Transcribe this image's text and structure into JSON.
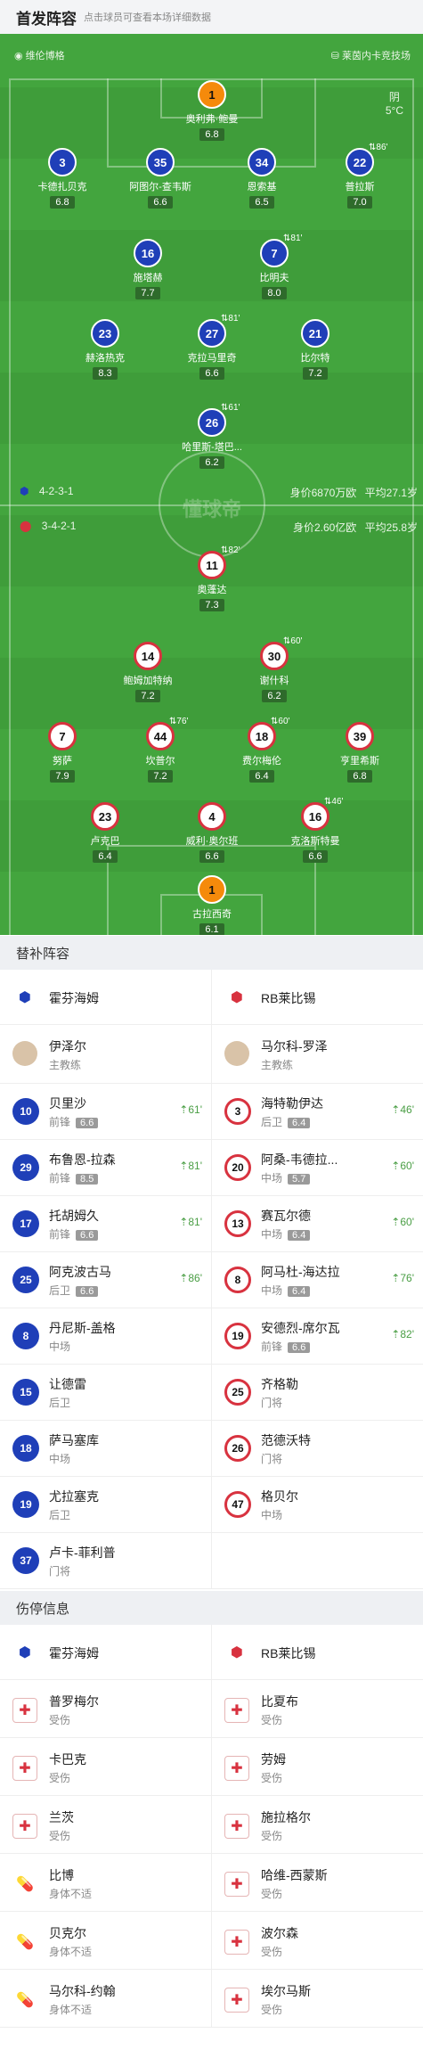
{
  "header": {
    "title": "首发阵容",
    "subtitle": "点击球员可查看本场详细数据"
  },
  "pitch": {
    "stadium": "维伦博格",
    "referee": "莱茵内卡竞技场",
    "weather": "阴",
    "temperature": "5°C",
    "watermark": "懂球帝",
    "home": {
      "formation": "4-2-3-1",
      "value": "身价6870万欧",
      "age": "平均27.1岁"
    },
    "away": {
      "formation": "3-4-2-1",
      "value": "身价2.60亿欧",
      "age": "平均25.8岁"
    }
  },
  "home_players": [
    {
      "num": "1",
      "name": "奥利弗·鲍曼",
      "rating": "6.8",
      "ev": ""
    },
    {
      "num": "3",
      "name": "卡德扎贝克",
      "rating": "6.8",
      "ev": ""
    },
    {
      "num": "35",
      "name": "阿图尔-查韦斯",
      "rating": "6.6",
      "ev": ""
    },
    {
      "num": "34",
      "name": "恩索基",
      "rating": "6.5",
      "ev": ""
    },
    {
      "num": "22",
      "name": "普拉斯",
      "rating": "7.0",
      "ev": "86'"
    },
    {
      "num": "16",
      "name": "施塔赫",
      "rating": "7.7",
      "ev": ""
    },
    {
      "num": "7",
      "name": "比明夫",
      "rating": "8.0",
      "ev": "81'"
    },
    {
      "num": "23",
      "name": "赫洛热克",
      "rating": "8.3",
      "ev": ""
    },
    {
      "num": "27",
      "name": "克拉马里奇",
      "rating": "6.6",
      "ev": "81'"
    },
    {
      "num": "21",
      "name": "比尔特",
      "rating": "7.2",
      "ev": ""
    },
    {
      "num": "26",
      "name": "哈里斯-塔巴...",
      "rating": "6.2",
      "ev": "61'"
    }
  ],
  "away_players": [
    {
      "num": "11",
      "name": "奥蓬达",
      "rating": "7.3",
      "ev": "82'"
    },
    {
      "num": "14",
      "name": "鲍姆加特纳",
      "rating": "7.2",
      "ev": ""
    },
    {
      "num": "30",
      "name": "谢什科",
      "rating": "6.2",
      "ev": "60'"
    },
    {
      "num": "7",
      "name": "努萨",
      "rating": "7.9",
      "ev": ""
    },
    {
      "num": "44",
      "name": "坎普尔",
      "rating": "7.2",
      "ev": "76'"
    },
    {
      "num": "18",
      "name": "费尔梅伦",
      "rating": "6.4",
      "ev": "60'"
    },
    {
      "num": "39",
      "name": "亨里希斯",
      "rating": "6.8",
      "ev": ""
    },
    {
      "num": "23",
      "name": "卢克巴",
      "rating": "6.4",
      "ev": ""
    },
    {
      "num": "4",
      "name": "威利·奥尔班",
      "rating": "6.6",
      "ev": ""
    },
    {
      "num": "16",
      "name": "克洛斯特曼",
      "rating": "6.6",
      "ev": "46'"
    },
    {
      "num": "1",
      "name": "古拉西奇",
      "rating": "6.1",
      "ev": ""
    }
  ],
  "subs": {
    "title": "替补阵容",
    "home_team": "霍芬海姆",
    "away_team": "RB莱比锡",
    "home_coach": {
      "name": "伊泽尔",
      "role": "主教练"
    },
    "away_coach": {
      "name": "马尔科-罗泽",
      "role": "主教练"
    },
    "home": [
      {
        "num": "10",
        "name": "贝里沙",
        "pos": "前锋",
        "rating": "6.6",
        "time": "61'"
      },
      {
        "num": "29",
        "name": "布鲁恩-拉森",
        "pos": "前锋",
        "rating": "8.5",
        "time": "81'"
      },
      {
        "num": "17",
        "name": "托胡姆久",
        "pos": "前锋",
        "rating": "6.6",
        "time": "81'"
      },
      {
        "num": "25",
        "name": "阿克波古马",
        "pos": "后卫",
        "rating": "6.6",
        "time": "86'"
      },
      {
        "num": "8",
        "name": "丹尼斯-盖格",
        "pos": "中场",
        "rating": "",
        "time": ""
      },
      {
        "num": "15",
        "name": "让德雷",
        "pos": "后卫",
        "rating": "",
        "time": ""
      },
      {
        "num": "18",
        "name": "萨马塞库",
        "pos": "中场",
        "rating": "",
        "time": ""
      },
      {
        "num": "19",
        "name": "尤拉塞克",
        "pos": "后卫",
        "rating": "",
        "time": ""
      },
      {
        "num": "37",
        "name": "卢卡-菲利普",
        "pos": "门将",
        "rating": "",
        "time": ""
      }
    ],
    "away": [
      {
        "num": "3",
        "name": "海特勒伊达",
        "pos": "后卫",
        "rating": "6.4",
        "time": "46'"
      },
      {
        "num": "20",
        "name": "阿桑-韦德拉...",
        "pos": "中场",
        "rating": "5.7",
        "time": "60'"
      },
      {
        "num": "13",
        "name": "赛瓦尔德",
        "pos": "中场",
        "rating": "6.4",
        "time": "60'"
      },
      {
        "num": "8",
        "name": "阿马杜-海达拉",
        "pos": "中场",
        "rating": "6.4",
        "time": "76'"
      },
      {
        "num": "19",
        "name": "安德烈-席尔瓦",
        "pos": "前锋",
        "rating": "6.6",
        "time": "82'"
      },
      {
        "num": "25",
        "name": "齐格勒",
        "pos": "门将",
        "rating": "",
        "time": ""
      },
      {
        "num": "26",
        "name": "范德沃特",
        "pos": "门将",
        "rating": "",
        "time": ""
      },
      {
        "num": "47",
        "name": "格贝尔",
        "pos": "中场",
        "rating": "",
        "time": ""
      }
    ]
  },
  "injuries": {
    "title": "伤停信息",
    "home_team": "霍芬海姆",
    "away_team": "RB莱比锡",
    "home": [
      {
        "name": "普罗梅尔",
        "status": "受伤",
        "type": "injury"
      },
      {
        "name": "卡巴克",
        "status": "受伤",
        "type": "injury"
      },
      {
        "name": "兰茨",
        "status": "受伤",
        "type": "injury"
      },
      {
        "name": "比博",
        "status": "身体不适",
        "type": "ill"
      },
      {
        "name": "贝克尔",
        "status": "身体不适",
        "type": "ill"
      },
      {
        "name": "马尔科-约翰",
        "status": "身体不适",
        "type": "ill"
      }
    ],
    "away": [
      {
        "name": "比夏布",
        "status": "受伤",
        "type": "injury"
      },
      {
        "name": "劳姆",
        "status": "受伤",
        "type": "injury"
      },
      {
        "name": "施拉格尔",
        "status": "受伤",
        "type": "injury"
      },
      {
        "name": "哈维-西蒙斯",
        "status": "受伤",
        "type": "injury"
      },
      {
        "name": "波尔森",
        "status": "受伤",
        "type": "injury"
      },
      {
        "name": "埃尔马斯",
        "status": "受伤",
        "type": "injury"
      }
    ]
  }
}
